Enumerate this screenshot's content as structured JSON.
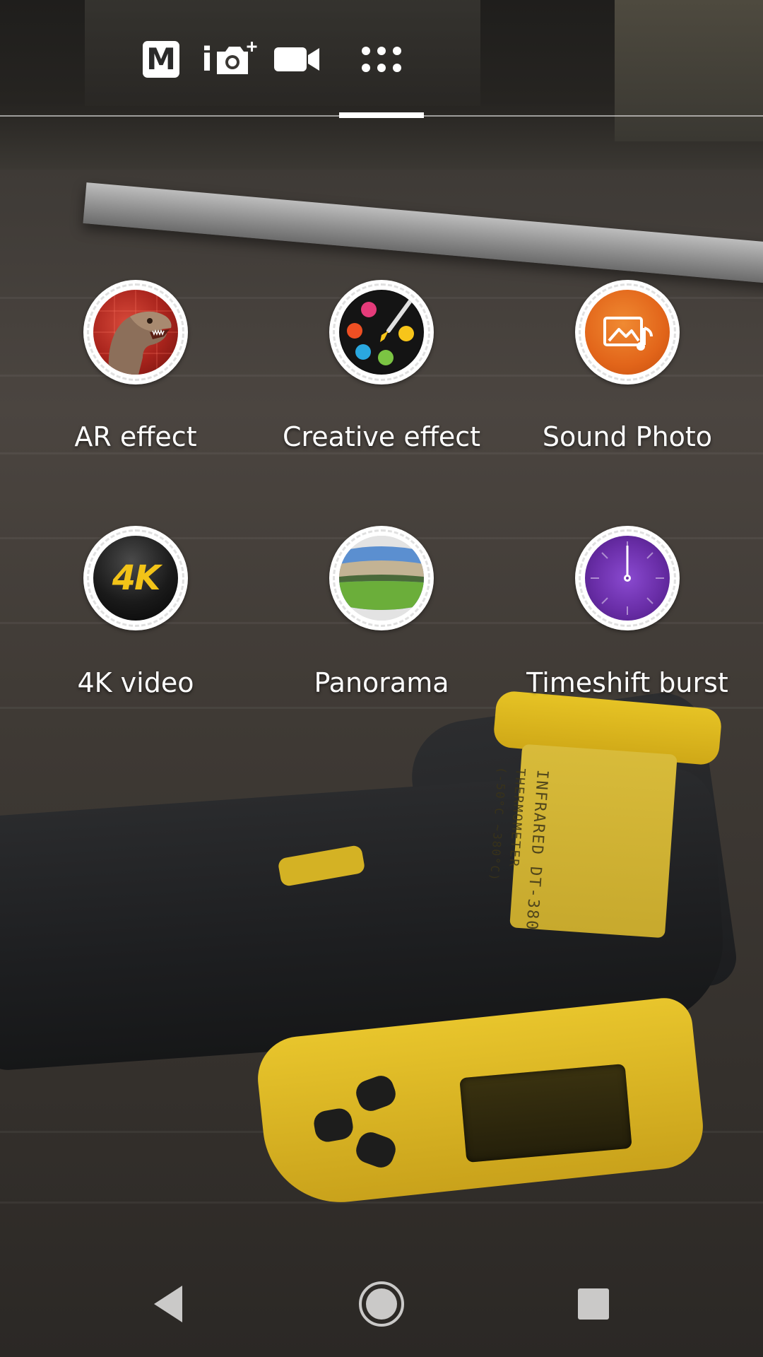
{
  "top_bar": {
    "modes": [
      {
        "icon": "manual-mode-icon",
        "label": "M"
      },
      {
        "icon": "superior-auto-icon",
        "label": "i"
      },
      {
        "icon": "video-icon",
        "label": ""
      },
      {
        "icon": "camera-apps-icon",
        "label": ""
      }
    ],
    "active_index": 3
  },
  "camera_apps": [
    {
      "label": "AR effect",
      "icon": "ar-effect-dinosaur-icon"
    },
    {
      "label": "Creative effect",
      "icon": "creative-effect-palette-icon"
    },
    {
      "label": "Sound Photo",
      "icon": "sound-photo-icon",
      "color": "#e2651a"
    },
    {
      "label": "4K video",
      "icon": "4k-video-icon",
      "badge": "4K",
      "badge_color": "#f2c318"
    },
    {
      "label": "Panorama",
      "icon": "panorama-icon"
    },
    {
      "label": "Timeshift burst",
      "icon": "timeshift-burst-icon",
      "color": "#6a2ea8"
    }
  ],
  "background": {
    "label_line1": "INFRARED  DT-380",
    "label_line2": "THERMOMETER",
    "label_line3": "(-50°C ~380°C)"
  },
  "nav_bar": {
    "back": "back-icon",
    "home": "home-icon",
    "recents": "recents-icon"
  }
}
